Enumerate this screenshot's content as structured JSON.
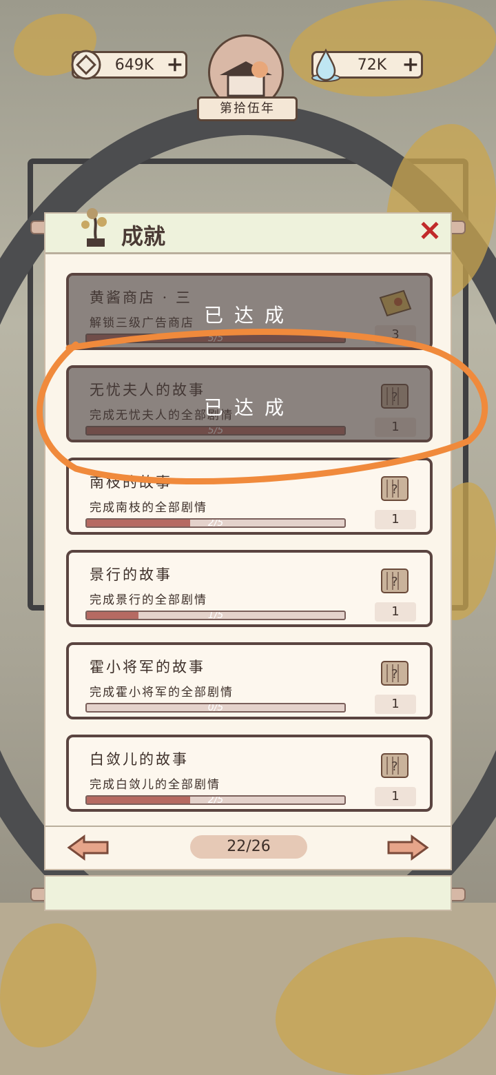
{
  "resources": {
    "coins": {
      "value": "649K",
      "icon": "coin-icon"
    },
    "water": {
      "value": "72K",
      "icon": "water-drop-icon"
    }
  },
  "year_badge": "第拾伍年",
  "panel": {
    "title": "成就",
    "close_icon": "close-icon"
  },
  "achievements": [
    {
      "name": "黄酱商店 · 三",
      "desc": "解锁三级广告商店",
      "progress": "5/5",
      "fraction": 1.0,
      "reward_count": "3",
      "reward_icon": "ticket-icon",
      "completed": true,
      "completed_label": "已达成"
    },
    {
      "name": "无忧夫人的故事",
      "desc": "完成无忧夫人的全部剧情",
      "progress": "5/5",
      "fraction": 1.0,
      "reward_count": "1",
      "reward_icon": "scroll-icon",
      "completed": true,
      "completed_label": "已达成"
    },
    {
      "name": "南枝的故事",
      "desc": "完成南枝的全部剧情",
      "progress": "2/5",
      "fraction": 0.4,
      "reward_count": "1",
      "reward_icon": "scroll-icon",
      "completed": false
    },
    {
      "name": "景行的故事",
      "desc": "完成景行的全部剧情",
      "progress": "1/5",
      "fraction": 0.2,
      "reward_count": "1",
      "reward_icon": "scroll-icon",
      "completed": false
    },
    {
      "name": "霍小将军的故事",
      "desc": "完成霍小将军的全部剧情",
      "progress": "0/5",
      "fraction": 0.0,
      "reward_count": "1",
      "reward_icon": "scroll-icon",
      "completed": false
    },
    {
      "name": "白敛儿的故事",
      "desc": "完成白敛儿的全部剧情",
      "progress": "2/5",
      "fraction": 0.4,
      "reward_count": "1",
      "reward_icon": "scroll-icon",
      "completed": false
    }
  ],
  "pager": {
    "page": "22/26",
    "prev_icon": "arrow-left-icon",
    "next_icon": "arrow-right-icon"
  },
  "colors": {
    "accent_red": "#c12a2a",
    "progress_fill": "#b66a62",
    "annotation_orange": "#f08a3c"
  }
}
